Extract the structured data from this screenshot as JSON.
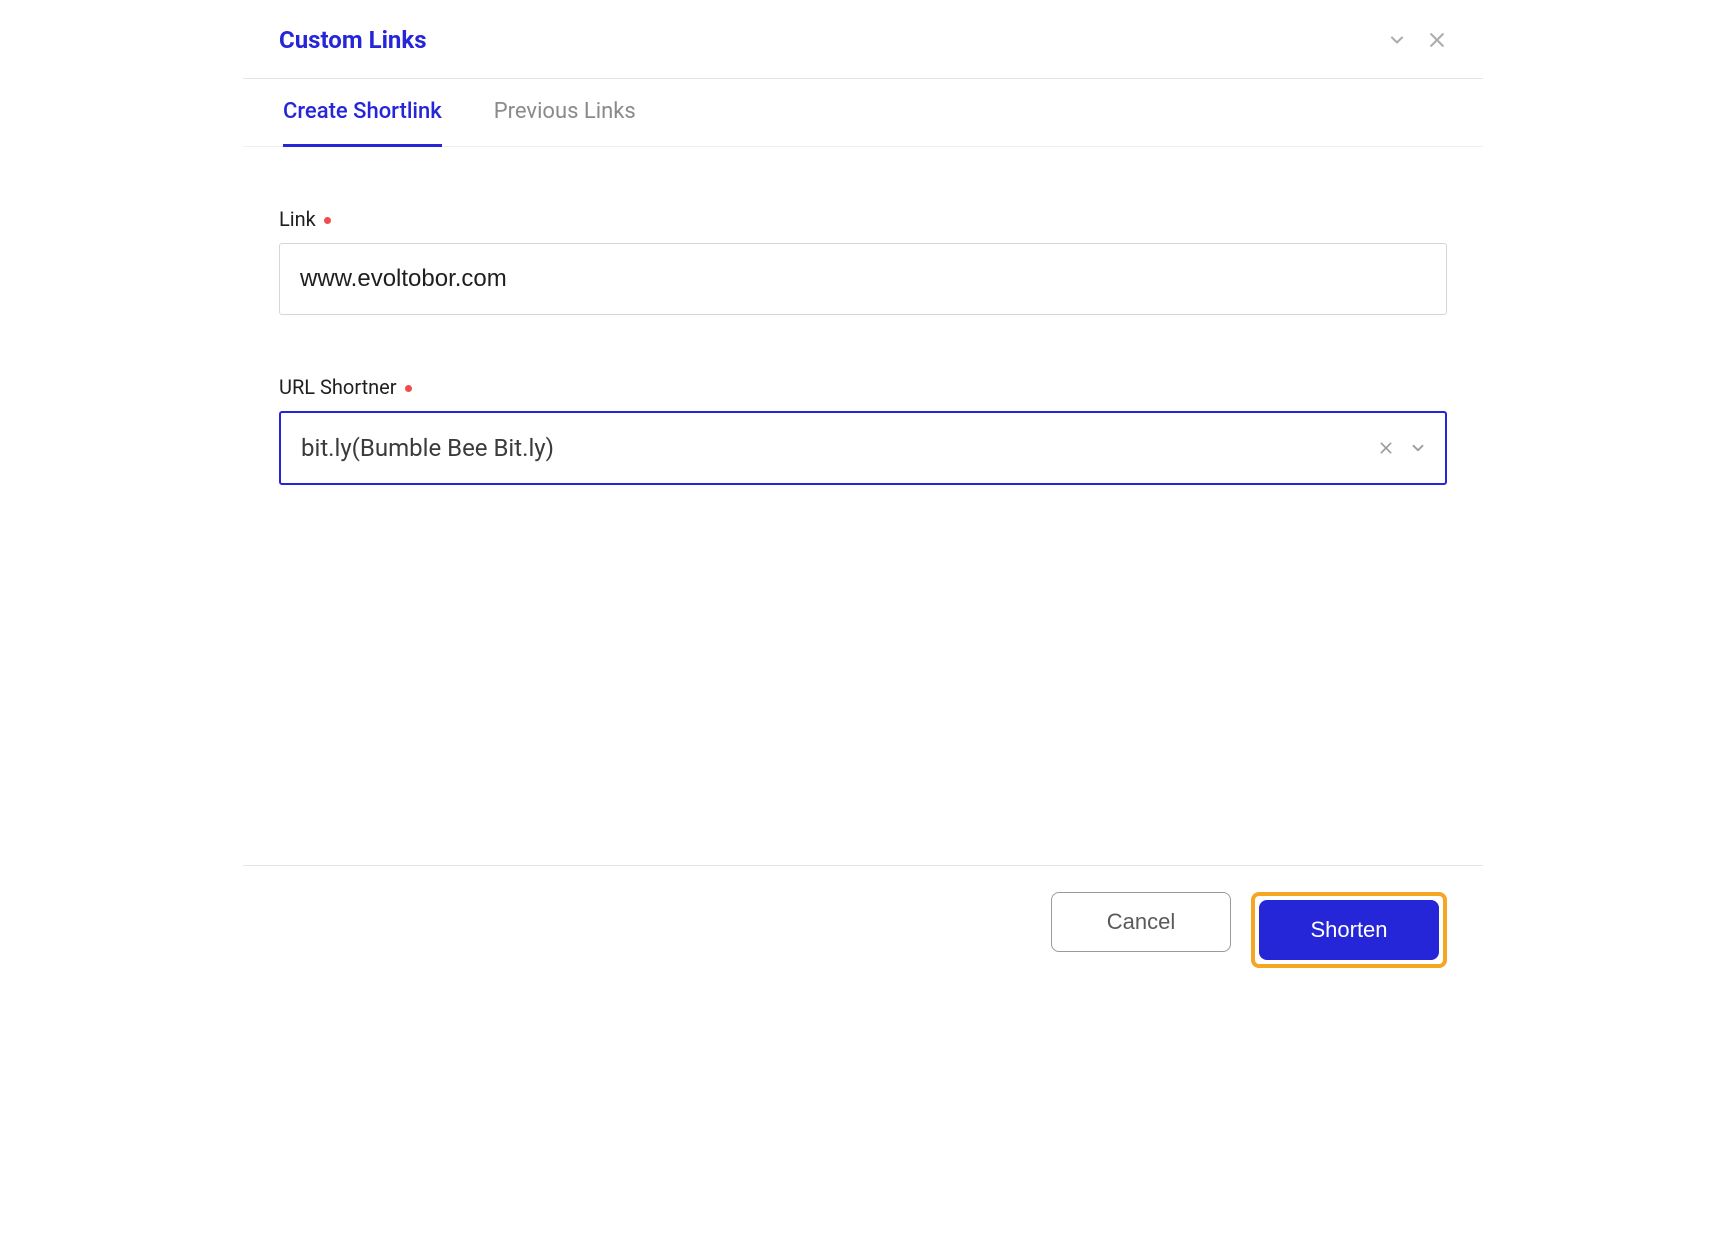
{
  "header": {
    "title": "Custom Links"
  },
  "tabs": {
    "create": "Create Shortlink",
    "previous": "Previous Links"
  },
  "form": {
    "link_label": "Link",
    "link_value": "www.evoltobor.com",
    "shortener_label": "URL Shortner",
    "shortener_value": "bit.ly(Bumble Bee Bit.ly)"
  },
  "footer": {
    "cancel": "Cancel",
    "shorten": "Shorten"
  }
}
